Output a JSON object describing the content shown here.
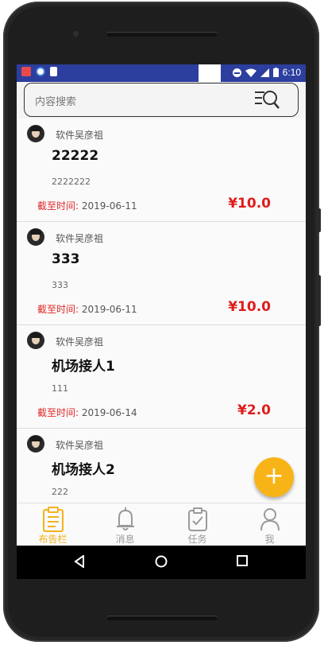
{
  "status_bar": {
    "time": "6:10",
    "icons": [
      "notification-app-icon",
      "circle-app-icon",
      "sd-card-icon",
      "do-not-disturb-icon",
      "wifi-icon",
      "signal-icon",
      "battery-icon"
    ]
  },
  "search": {
    "placeholder": "内容搜索"
  },
  "posts": [
    {
      "author": "软件吴彦祖",
      "title": "22222",
      "desc": "2222222",
      "deadline_label": "截至时间:",
      "deadline": "2019-06-11",
      "price": "¥10.0"
    },
    {
      "author": "软件吴彦祖",
      "title": "333",
      "desc": "333",
      "deadline_label": "截至时间:",
      "deadline": "2019-06-11",
      "price": "¥10.0"
    },
    {
      "author": "软件吴彦祖",
      "title": "机场接人1",
      "desc": "111",
      "deadline_label": "截至时间:",
      "deadline": "2019-06-14",
      "price": "¥2.0"
    },
    {
      "author": "软件吴彦祖",
      "title": "机场接人2",
      "desc": "222",
      "deadline_label": "",
      "deadline": "",
      "price": ""
    }
  ],
  "fab": {
    "label": "+"
  },
  "bottom_nav": [
    {
      "label": "布告栏",
      "icon": "clipboard-icon",
      "active": true
    },
    {
      "label": "消息",
      "icon": "bell-icon",
      "active": false
    },
    {
      "label": "任务",
      "icon": "task-icon",
      "active": false
    },
    {
      "label": "我",
      "icon": "person-icon",
      "active": false
    }
  ],
  "colors": {
    "accent": "#f4b21c",
    "price": "#e01c1c",
    "status_bar": "#2c3e9e"
  }
}
